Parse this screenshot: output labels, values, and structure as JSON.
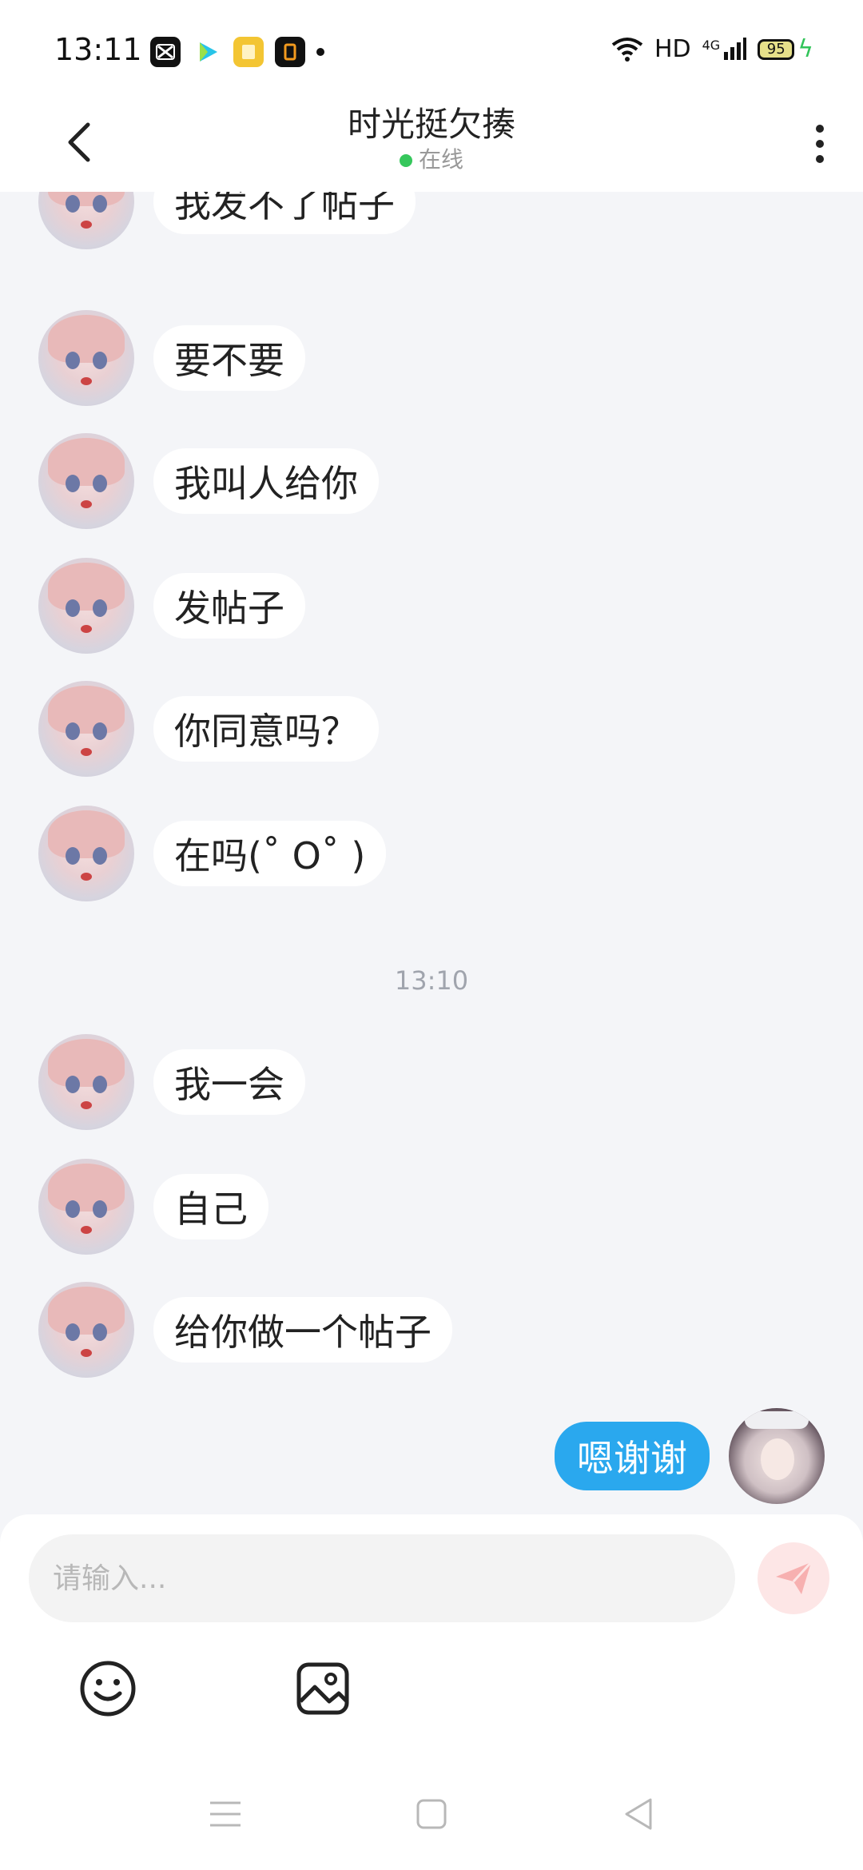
{
  "status_bar": {
    "time": "13:11",
    "network": "HD",
    "signal_type": "4G",
    "battery": "95",
    "icons": [
      "capcut-icon",
      "video-app-icon",
      "notes-app-icon",
      "reader-app-icon",
      "more-dot-icon",
      "wifi-icon",
      "signal-icon",
      "battery-icon",
      "charging-icon"
    ]
  },
  "header": {
    "title": "时光挺欠揍",
    "status": "在线",
    "status_color": "#36c75c"
  },
  "messages": [
    {
      "from": "other",
      "text": "我发不了帖子"
    },
    {
      "from": "other",
      "text": "要不要"
    },
    {
      "from": "other",
      "text": "我叫人给你"
    },
    {
      "from": "other",
      "text": "发帖子"
    },
    {
      "from": "other",
      "text": "你同意吗？"
    },
    {
      "from": "other",
      "text": "在吗(˚ O˚ )"
    },
    {
      "from": "other",
      "text": "我一会"
    },
    {
      "from": "other",
      "text": "自己"
    },
    {
      "from": "other",
      "text": "给你做一个帖子"
    },
    {
      "from": "me",
      "text": "嗯谢谢"
    }
  ],
  "timestamp": "13:10",
  "input": {
    "placeholder": "请输入...",
    "value": ""
  },
  "colors": {
    "outgoing_bubble": "#2aa8ee",
    "send_button": "#fde6e6",
    "background": "#f4f5f8"
  }
}
